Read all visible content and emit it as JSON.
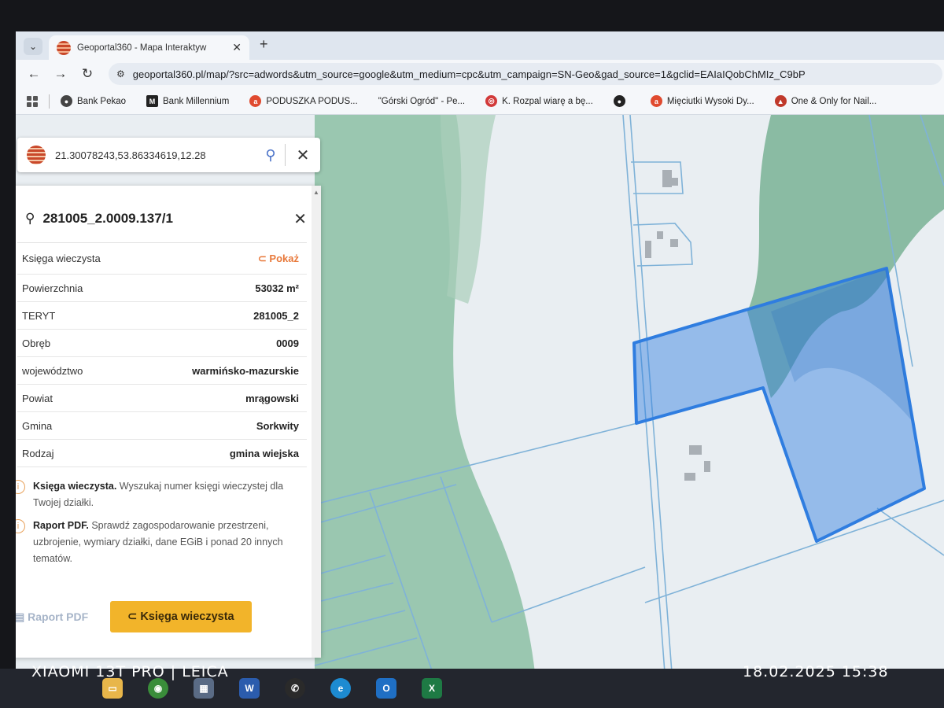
{
  "browser": {
    "tab_title": "Geoportal360 - Mapa Interaktyw",
    "url": "geoportal360.pl/map/?src=adwords&utm_source=google&utm_medium=cpc&utm_campaign=SN-Geo&gad_source=1&gclid=EAIaIQobChMIz_C9bP",
    "bookmarks": [
      {
        "label": "Bank Pekao",
        "icon_color": "#444444"
      },
      {
        "label": "Bank Millennium",
        "icon_color": "#222222"
      },
      {
        "label": "PODUSZKA PODUS...",
        "icon_color": "#e04a2f"
      },
      {
        "label": "\"Górski Ogród\" - Pe...",
        "icon_color": ""
      },
      {
        "label": "K. Rozpal wiarę a bę...",
        "icon_color": "#d23a3a"
      },
      {
        "label": "",
        "icon_color": "#222222"
      },
      {
        "label": "Mięciutki Wysoki Dy...",
        "icon_color": "#e04a2f"
      },
      {
        "label": "One & Only for Nail...",
        "icon_color": "#c0392b"
      }
    ]
  },
  "search": {
    "value": "21.30078243,53.86334619,12.28"
  },
  "parcel": {
    "id": "281005_2.0009.137/1",
    "kw_label": "Księga wieczysta",
    "kw_link": "Pokaż",
    "fields": [
      {
        "label": "Powierzchnia",
        "value": "53032 m²"
      },
      {
        "label": "TERYT",
        "value": "281005_2"
      },
      {
        "label": "Obręb",
        "value": "0009"
      },
      {
        "label": "województwo",
        "value": "warmińsko-mazurskie"
      },
      {
        "label": "Powiat",
        "value": "mrągowski"
      },
      {
        "label": "Gmina",
        "value": "Sorkwity"
      },
      {
        "label": "Rodzaj",
        "value": "gmina wiejska"
      }
    ],
    "note_kw_title": "Księga wieczysta.",
    "note_kw_text": "Wyszukaj numer księgi wieczystej dla Twojej działki.",
    "note_pdf_title": "Raport PDF.",
    "note_pdf_text": "Sprawdź zagospodarowanie przestrzeni, uzbrojenie, wymiary działki, dane EGiB i ponad 20 innych tematów.",
    "btn_pdf": "Raport PDF",
    "btn_kw": "Księga wieczysta"
  },
  "colors": {
    "accent_link": "#e8793b",
    "button_kw": "#f2b42a",
    "parcel_fill": "#2f7de0",
    "forest": "#7fb59a"
  },
  "photo_overlay": {
    "brand": "XIAOMI 13T PRO | LEICA",
    "timestamp": "18.02.2025  15:38"
  }
}
